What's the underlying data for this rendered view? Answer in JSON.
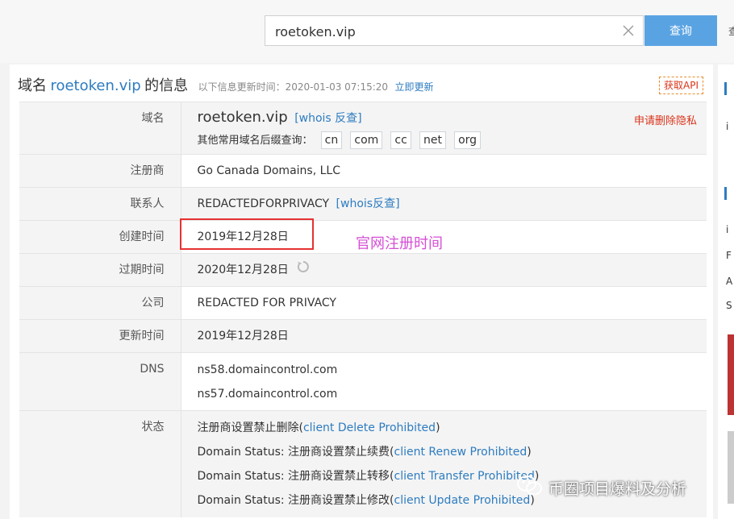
{
  "search": {
    "value": "roetoken.vip",
    "button_label": "查询"
  },
  "right_edge_glyph": "查",
  "header": {
    "title_prefix": "域名",
    "title_domain": "roetoken.vip",
    "title_suffix": "的信息",
    "update_info": "以下信息更新时间：2020-01-03 07:15:20",
    "update_link": "立即更新",
    "api_button": "获取API"
  },
  "domain_row": {
    "label": "域名",
    "domain": "roetoken.vip",
    "whois_link": "[whois 反查]",
    "suffix_prompt": "其他常用域名后缀查询：",
    "suffixes": [
      "cn",
      "com",
      "cc",
      "net",
      "org"
    ],
    "delete_privacy": "申请删除隐私"
  },
  "rows": {
    "registrar": {
      "label": "注册商",
      "value": "Go Canada Domains, LLC"
    },
    "contact": {
      "label": "联系人",
      "value": "REDACTEDFORPRIVACY",
      "link": "[whois反查]"
    },
    "created": {
      "label": "创建时间",
      "value": "2019年12月28日"
    },
    "expires": {
      "label": "过期时间",
      "value": "2020年12月28日"
    },
    "company": {
      "label": "公司",
      "value": "REDACTED FOR PRIVACY"
    },
    "updated": {
      "label": "更新时间",
      "value": "2019年12月28日"
    },
    "dns": {
      "label": "DNS",
      "values": [
        "ns58.domaincontrol.com",
        "ns57.domaincontrol.com"
      ]
    },
    "status": {
      "label": "状态",
      "items": [
        {
          "prefix": "注册商设置禁止删除(",
          "link": "client Delete Prohibited",
          "suffix": ")"
        },
        {
          "prefix": "Domain Status: 注册商设置禁止续费(",
          "link": "client Renew Prohibited",
          "suffix": ")"
        },
        {
          "prefix": "Domain Status: 注册商设置禁止转移(",
          "link": "client Transfer Prohibited",
          "suffix": ")"
        },
        {
          "prefix": "Domain Status: 注册商设置禁止修改(",
          "link": "client Update Prohibited",
          "suffix": ")"
        }
      ]
    }
  },
  "annotation": "官网注册时间",
  "right_column_letters": [
    "i",
    "i",
    "F",
    "A",
    "S"
  ],
  "watermark": {
    "text": "币圈项目爆料及分析"
  },
  "colors": {
    "link": "#2d7cc0",
    "button": "#5aa3e3",
    "alert": "#d9341a",
    "annotation": "#d64fd6",
    "highlight": "#e63232"
  },
  "icons": [
    "clear-icon",
    "refresh-icon",
    "wechat-icon"
  ]
}
